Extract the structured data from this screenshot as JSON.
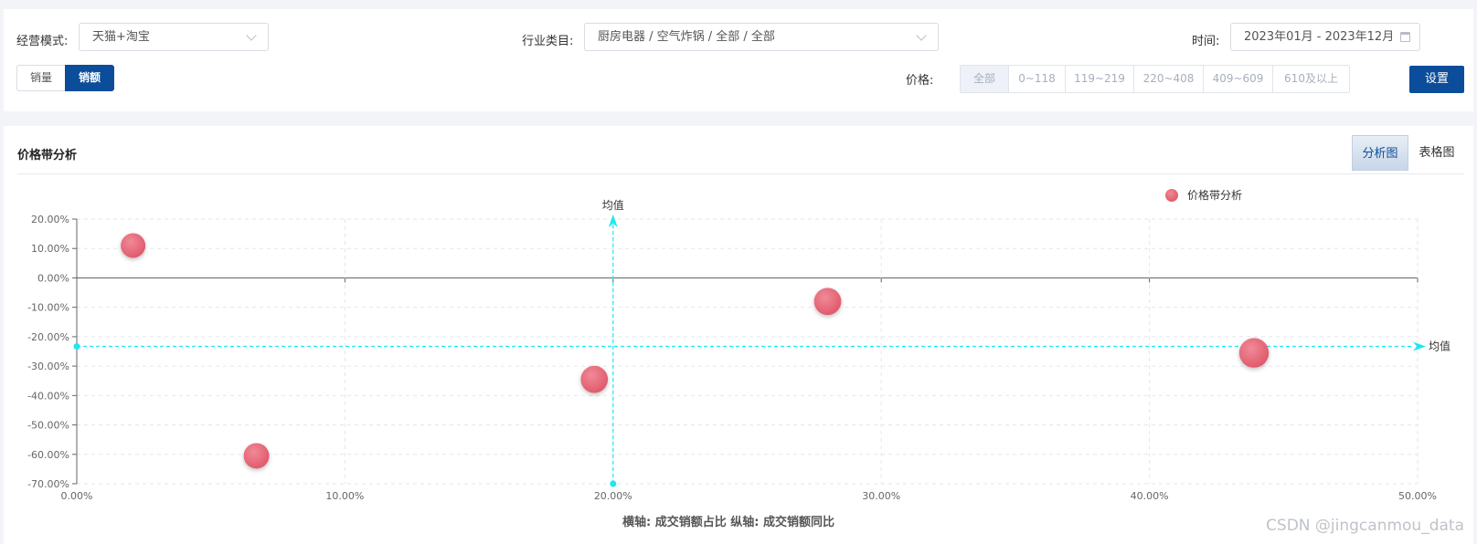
{
  "filters": {
    "mode_label": "经营模式:",
    "mode_value": "天猫+淘宝",
    "industry_label": "行业类目:",
    "industry_value": "厨房电器 / 空气炸锅 / 全部 / 全部",
    "time_label": "时间:",
    "time_value": "2023年01月 - 2023年12月",
    "metric_tabs": [
      "销量",
      "销额"
    ],
    "metric_selected": "销额",
    "price_label": "价格:",
    "price_options": [
      "全部",
      "0~118",
      "119~219",
      "220~408",
      "409~609",
      "610及以上"
    ],
    "price_selected": "全部",
    "settings_label": "设置"
  },
  "panel": {
    "title": "价格带分析",
    "view_tabs": [
      "分析图",
      "表格图"
    ],
    "view_selected": "分析图"
  },
  "chart_data": {
    "type": "scatter",
    "legend": [
      "价格带分析"
    ],
    "legend_position": "top-right",
    "xlim": [
      0,
      50
    ],
    "ylim": [
      -70,
      20
    ],
    "x_ticks": [
      "0.00%",
      "10.00%",
      "20.00%",
      "30.00%",
      "40.00%",
      "50.00%"
    ],
    "y_ticks": [
      "20.00%",
      "10.00%",
      "0.00%",
      "-10.00%",
      "-20.00%",
      "-30.00%",
      "-40.00%",
      "-50.00%",
      "-60.00%",
      "-70.00%"
    ],
    "axis_caption": "横轴: 成交销额占比  纵轴: 成交销额同比",
    "mean_label": "均值",
    "mean_x": 20,
    "mean_y": -23.3,
    "series": [
      {
        "name": "价格带分析",
        "color": "#e05a6c",
        "points": [
          {
            "x": 2.1,
            "y": 11.0,
            "size": 0.5
          },
          {
            "x": 6.7,
            "y": -60.5,
            "size": 0.55
          },
          {
            "x": 19.3,
            "y": -34.5,
            "size": 0.65
          },
          {
            "x": 28.0,
            "y": -8.0,
            "size": 0.65
          },
          {
            "x": 43.9,
            "y": -25.5,
            "size": 0.8
          }
        ]
      }
    ],
    "mean_line_color": "#1ee8ef",
    "grid": true
  },
  "watermark": "CSDN @jingcanmou_data"
}
